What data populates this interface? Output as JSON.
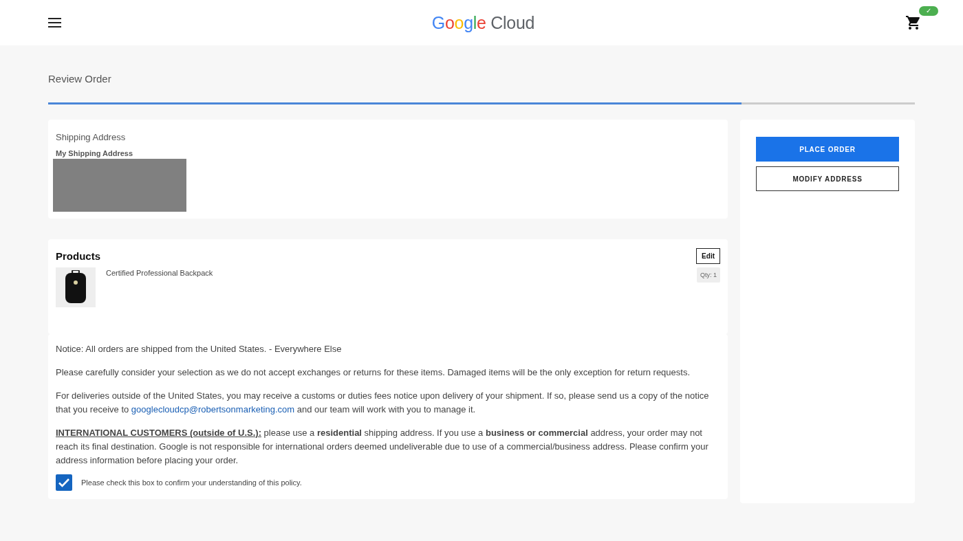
{
  "header": {
    "logo_brand": "Google",
    "logo_product": "Cloud",
    "cart_badge": "✓"
  },
  "page_title": "Review Order",
  "progress": {
    "level": 0.8
  },
  "shipping": {
    "heading": "Shipping Address",
    "address_name": "My Shipping Address"
  },
  "products": {
    "heading": "Products",
    "edit_button": "Edit",
    "items": [
      {
        "name": "Certified Professional Backpack",
        "qty": "Qty: 1"
      }
    ]
  },
  "notice": {
    "line": "Notice: All orders are shipped from the United States. - Everywhere Else",
    "returns": "Please carefully consider your selection as we do not accept exchanges or returns for these items. Damaged items will be the only exception for return requests.",
    "customs": {
      "before": "For deliveries outside of the United States, you may receive a customs or duties fees notice upon delivery of your shipment. If so, please send us a copy of the notice that you receive to",
      "link": "googlecloudcp@robertsonmarketing.com",
      "after": "and our team will work with you to manage it."
    },
    "international": {
      "lead": "INTERNATIONAL CUSTOMERS (outside of U.S.):",
      "rest": " please use a **residential** shipping address. If you use a **business or commercial** address, your order may not reach its final destination. Google is not responsible for international orders deemed undeliverable due to use of a commercial/business address. Please confirm your address information before placing your order."
    },
    "confirm": {
      "label": "Please check this box to confirm your understanding of this policy.",
      "checked": true
    }
  },
  "actions": {
    "primary": "PLACE ORDER",
    "secondary": "MODIFY ADDRESS"
  }
}
